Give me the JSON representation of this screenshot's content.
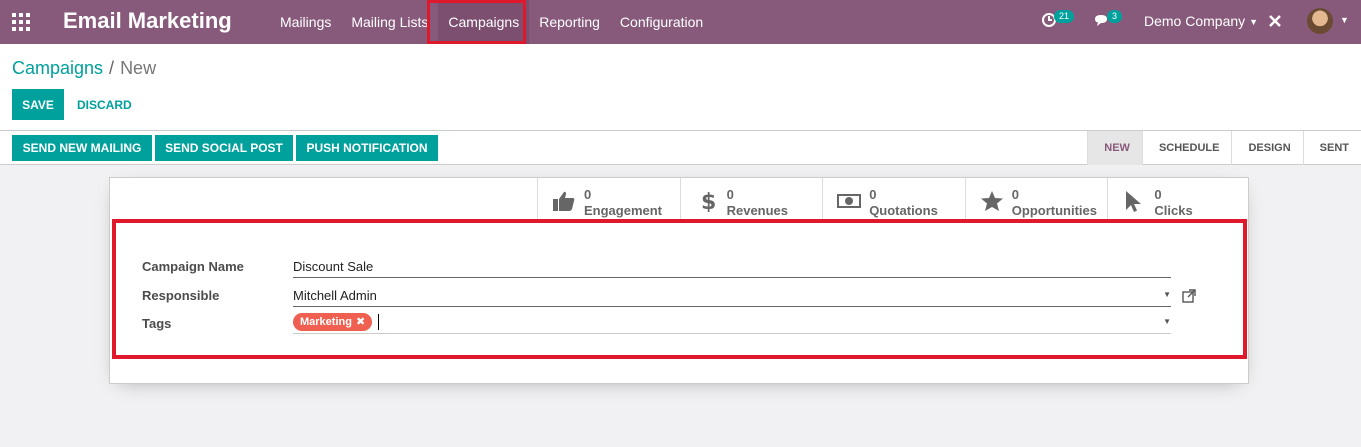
{
  "navbar": {
    "app_title": "Email Marketing",
    "menu": [
      "Mailings",
      "Mailing Lists",
      "Campaigns",
      "Reporting",
      "Configuration"
    ],
    "activity_count": "21",
    "messages_count": "3",
    "company": "Demo Company"
  },
  "breadcrumb": {
    "parent": "Campaigns",
    "separator": "/",
    "current": "New"
  },
  "buttons": {
    "save": "SAVE",
    "discard": "DISCARD"
  },
  "actions": [
    "SEND NEW MAILING",
    "SEND SOCIAL POST",
    "PUSH NOTIFICATION"
  ],
  "stages": [
    "NEW",
    "SCHEDULE",
    "DESIGN",
    "SENT"
  ],
  "stats": [
    {
      "value": "0",
      "label": "Engagement",
      "icon": "thumbs-up-icon"
    },
    {
      "value": "0",
      "label": "Revenues",
      "icon": "dollar-icon"
    },
    {
      "value": "0",
      "label": "Quotations",
      "icon": "money-bill-icon"
    },
    {
      "value": "0",
      "label": "Opportunities",
      "icon": "star-icon"
    },
    {
      "value": "0",
      "label": "Clicks",
      "icon": "pointer-icon"
    }
  ],
  "form": {
    "campaign_name_label": "Campaign Name",
    "campaign_name_value": "Discount Sale",
    "responsible_label": "Responsible",
    "responsible_value": "Mitchell Admin",
    "tags_label": "Tags",
    "tag": "Marketing",
    "tag_remove": "✖"
  },
  "colors": {
    "brand": "#875a7b",
    "accent": "#00a09d",
    "highlight": "#e0182b",
    "tag": "#f06050"
  }
}
